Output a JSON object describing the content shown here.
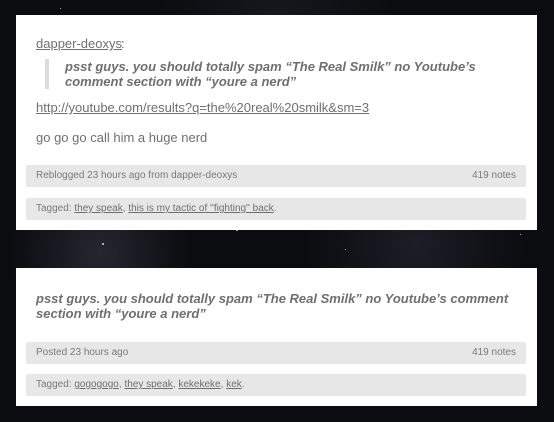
{
  "post1": {
    "author": "dapper-deoxys",
    "colon": ":",
    "quote": "psst guys. you should totally spam “The Real Smilk” no Youtube’s comment section with “youre a nerd”",
    "link": "http://youtube.com/results?q=the%20real%20smilk&sm=3",
    "body": "go go go call him a huge nerd",
    "meta_left": "Reblogged 23 hours ago from dapper-deoxys",
    "notes": "419 notes",
    "tags_label": "Tagged:",
    "tags": [
      "they speak",
      "this is my tactic of ''fighting'' back"
    ],
    "tags_end": "."
  },
  "post2": {
    "body": "psst guys. you should totally spam “The Real Smilk” no Youtube’s comment section with “youre a nerd”",
    "meta_left": "Posted 23 hours ago",
    "notes": "419 notes",
    "tags_label": "Tagged:",
    "tags": [
      "gogogogo",
      "they speak",
      "kekekeke",
      "kek"
    ],
    "tags_end": "."
  }
}
